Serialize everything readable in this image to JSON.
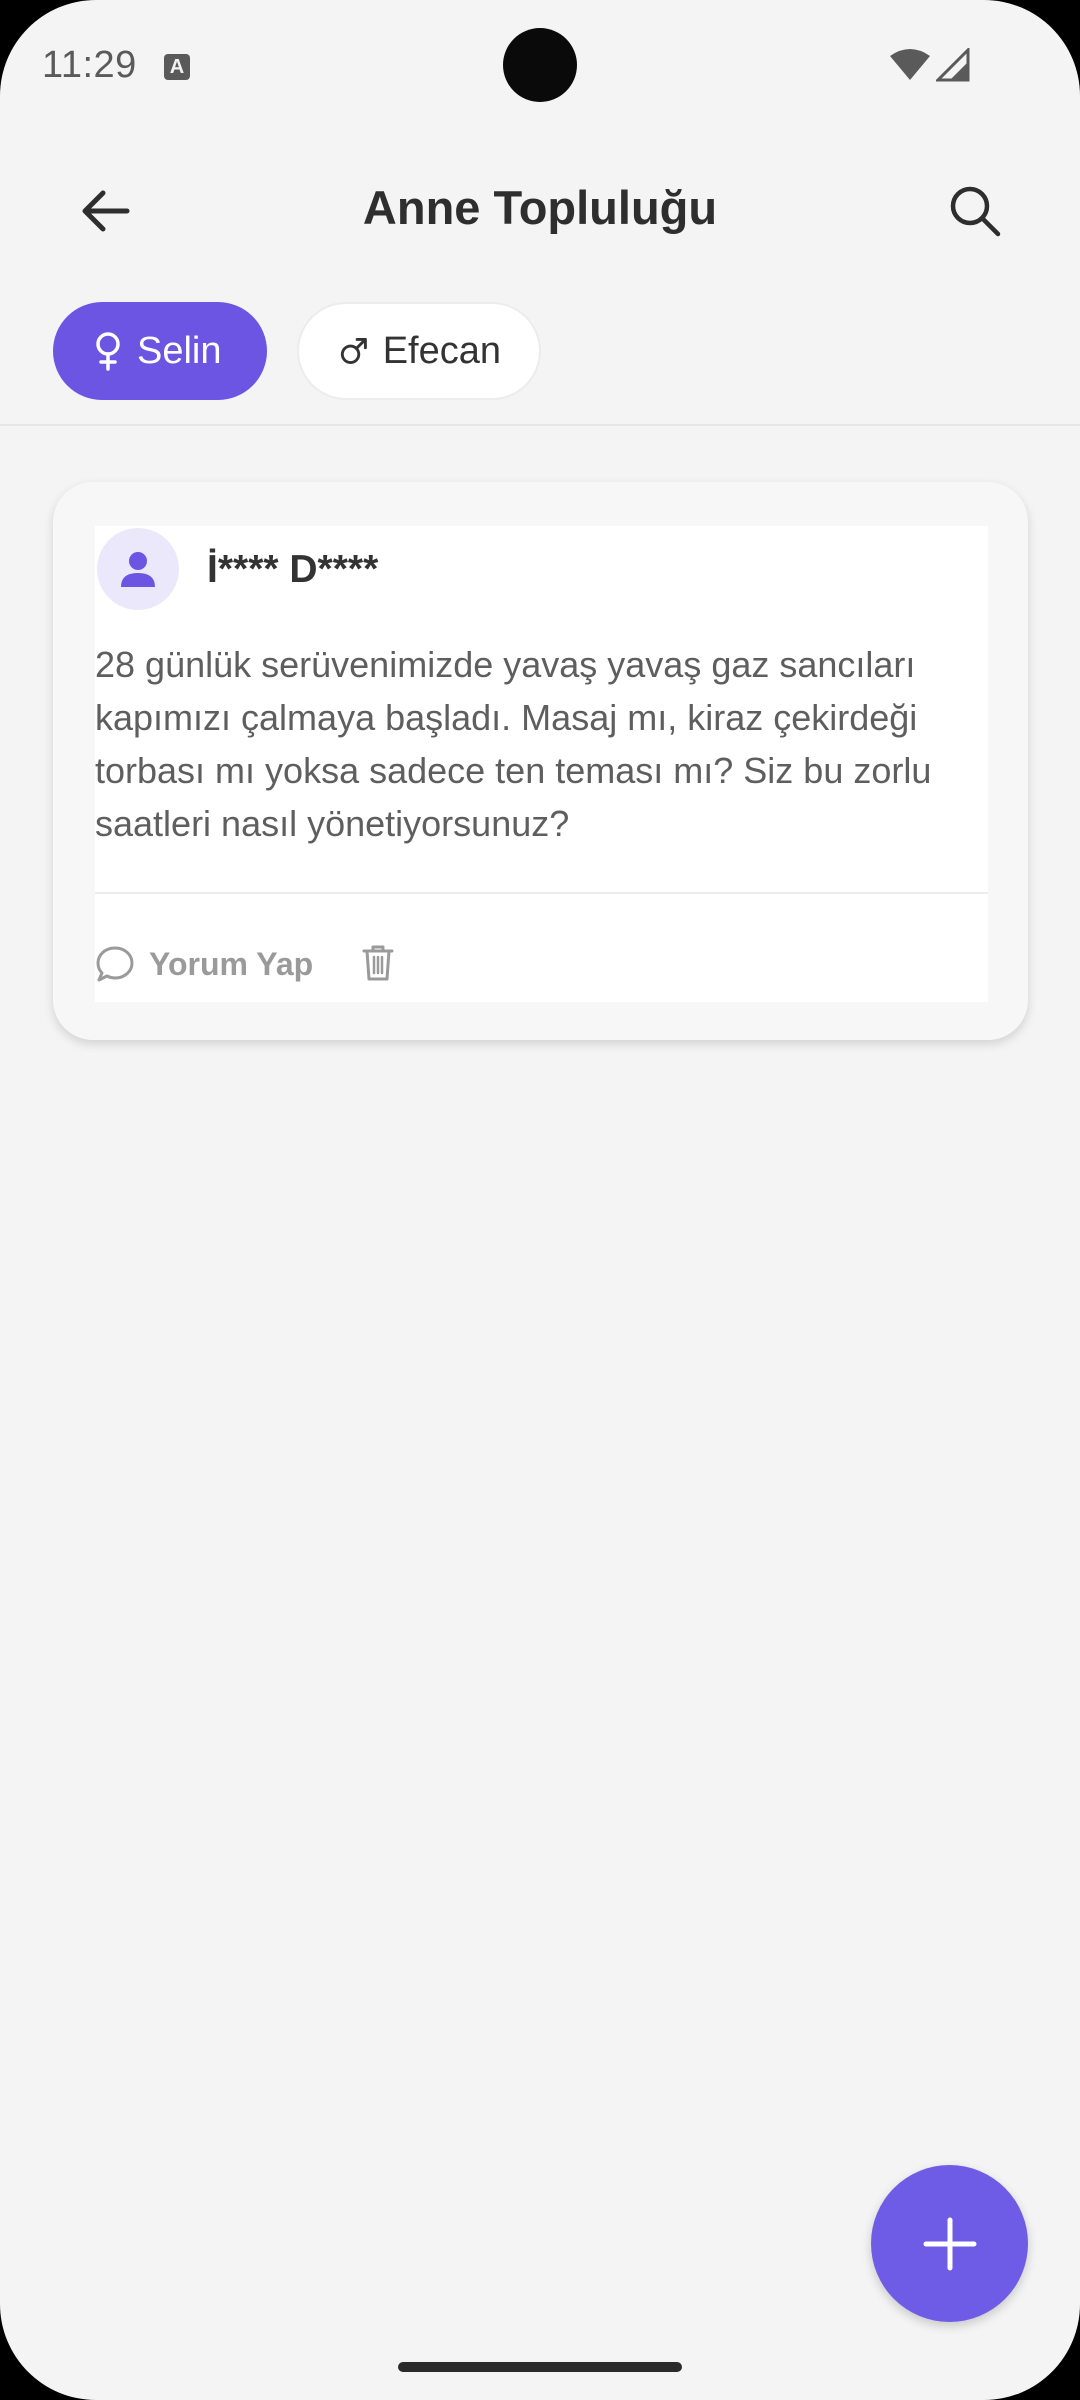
{
  "status_bar": {
    "time": "11:29",
    "notification_glyph": "A"
  },
  "app_bar": {
    "title": "Anne Topluluğu"
  },
  "chips": [
    {
      "label": "Selin",
      "icon": "female-icon",
      "selected": true
    },
    {
      "label": "Efecan",
      "icon": "male-icon",
      "selected": false
    }
  ],
  "post": {
    "author": "İ**** D****",
    "body": "28 günlük serüvenimizde yavaş yavaş gaz sancıları kapımızı çalmaya başladı. Masaj mı, kiraz çekirdeği torbası mı yoksa sadece ten teması mı? Siz bu zorlu saatleri nasıl yönetiyorsunuz?",
    "comment_label": "Yorum Yap"
  },
  "colors": {
    "accent": "#6b55e2",
    "background": "#f4f4f4"
  }
}
